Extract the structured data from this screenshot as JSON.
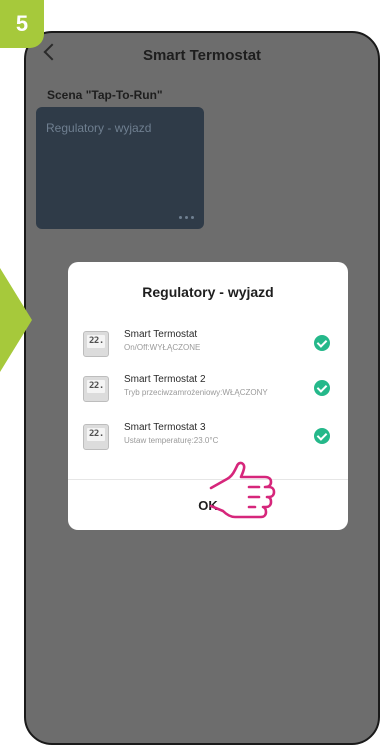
{
  "step_number": "5",
  "colors": {
    "accent": "#a6c93b",
    "hand": "#d6267b",
    "check": "#25b88a",
    "overlay": "#6d6d6d",
    "scene_card": "#2f3b48"
  },
  "header": {
    "title": "Smart Termostat",
    "back_icon": "chevron-left-icon"
  },
  "section_title": "Scena \"Tap-To-Run\"",
  "scene_card": {
    "label": "Regulatory - wyjazd",
    "more_icon": "more-horizontal-icon"
  },
  "dialog": {
    "title": "Regulatory - wyjazd",
    "items": [
      {
        "thumb_text": "22.",
        "name": "Smart Termostat",
        "status": "On/Off:WYŁĄCZONE",
        "icon": "check-circle-icon"
      },
      {
        "thumb_text": "22.",
        "name": "Smart Termostat 2",
        "status": "Tryb przeciwzamrożeniowy:WŁĄCZONY",
        "icon": "check-circle-icon"
      },
      {
        "thumb_text": "22.",
        "name": "Smart Termostat 3",
        "status": "Ustaw temperaturę:23.0°C",
        "icon": "check-circle-icon"
      }
    ],
    "ok_label": "OK"
  },
  "pointer_icon": "pointing-hand-icon"
}
